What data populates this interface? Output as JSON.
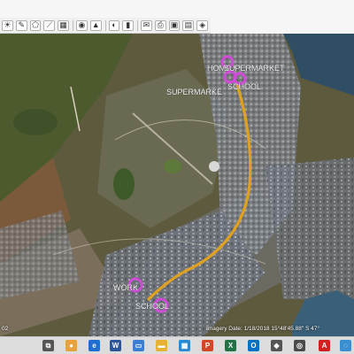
{
  "toolbar": {
    "buttons": [
      {
        "name": "sun-tool",
        "icon": "sun-icon",
        "glyph": "☀"
      },
      {
        "name": "edit-tool",
        "icon": "pencil-icon",
        "glyph": "✎"
      },
      {
        "name": "polygon-tool",
        "icon": "polygon-icon",
        "glyph": "⬠"
      },
      {
        "name": "path-tool",
        "icon": "path-icon",
        "glyph": "⟋"
      },
      {
        "name": "overlay-tool",
        "icon": "overlay-icon",
        "glyph": "▦"
      },
      {
        "name": "globe-tool",
        "icon": "globe-icon",
        "glyph": "◉"
      },
      {
        "name": "terrain-tool",
        "icon": "mountain-icon",
        "glyph": "▲"
      },
      {
        "name": "planet-tool",
        "icon": "planet-icon",
        "glyph": "◐"
      },
      {
        "name": "ruler-tool",
        "icon": "ruler-icon",
        "glyph": "▮"
      },
      {
        "name": "email-tool",
        "icon": "envelope-icon",
        "glyph": "✉"
      },
      {
        "name": "print-tool",
        "icon": "printer-icon",
        "glyph": "⎙"
      },
      {
        "name": "save-image-tool",
        "icon": "camera-icon",
        "glyph": "▣"
      },
      {
        "name": "maps-tool",
        "icon": "map-icon",
        "glyph": "▤"
      },
      {
        "name": "layers-tool",
        "icon": "layers-icon",
        "glyph": "◈"
      }
    ]
  },
  "map": {
    "placemarks": [
      {
        "name": "home",
        "label": "HOME"
      },
      {
        "name": "supermarket-1",
        "label": "SUPERMARKET"
      },
      {
        "name": "school-1",
        "label": "SCHOOL"
      },
      {
        "name": "supermarket-2",
        "label": "SUPERMARKE"
      },
      {
        "name": "work",
        "label": "WORK"
      },
      {
        "name": "school-2",
        "label": "SCHOOL"
      }
    ],
    "status_text": "Imagery Date: 1/18/2018   15°48'45.88\" S  47°",
    "corner_text": "02",
    "route_color": "#e0a020",
    "placemark_color": "#d04bd8"
  },
  "taskbar": {
    "apps": [
      {
        "name": "task-view-icon",
        "glyph": "⧉",
        "color": "#555555"
      },
      {
        "name": "chrome-icon",
        "glyph": "●",
        "color": "#e8a23a"
      },
      {
        "name": "edge-icon",
        "glyph": "e",
        "color": "#1f6fd1"
      },
      {
        "name": "word-icon",
        "glyph": "W",
        "color": "#2b579a"
      },
      {
        "name": "desktop-icon",
        "glyph": "▭",
        "color": "#3a7fd1"
      },
      {
        "name": "folder-icon",
        "glyph": "▬",
        "color": "#e6b233"
      },
      {
        "name": "store-icon",
        "glyph": "▦",
        "color": "#2a8ad1"
      },
      {
        "name": "powerpoint-icon",
        "glyph": "P",
        "color": "#d24726"
      },
      {
        "name": "excel-icon",
        "glyph": "X",
        "color": "#217346"
      },
      {
        "name": "outlook-icon",
        "glyph": "O",
        "color": "#0072c6"
      },
      {
        "name": "shield-icon",
        "glyph": "◆",
        "color": "#555555"
      },
      {
        "name": "google-earth-icon",
        "glyph": "◎",
        "color": "#4a4a4a"
      },
      {
        "name": "acrobat-icon",
        "glyph": "A",
        "color": "#d31f1f"
      },
      {
        "name": "search-app-icon",
        "glyph": "◌",
        "color": "#3a8fd1"
      }
    ]
  }
}
